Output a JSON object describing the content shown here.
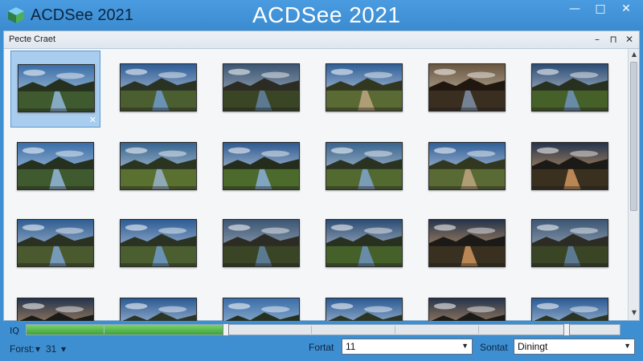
{
  "titlebar": {
    "app_name": "ACDSee 2021",
    "center_title": "ACDSee 2021",
    "minimize": "—",
    "maximize": "□",
    "close": "✕"
  },
  "panel": {
    "title": "Pecte Craet",
    "controls": [
      "–",
      "⊓",
      "✕"
    ]
  },
  "grid": {
    "selected_close": "✕",
    "thumbnails": [
      {
        "scene": "valley-river"
      },
      {
        "scene": "mountain-river"
      },
      {
        "scene": "castle-lake"
      },
      {
        "scene": "country-road"
      },
      {
        "scene": "cave-path"
      },
      {
        "scene": "tree-stream"
      },
      {
        "scene": "valley-river"
      },
      {
        "scene": "field-trees"
      },
      {
        "scene": "canal-reflection"
      },
      {
        "scene": "lake-field"
      },
      {
        "scene": "country-road"
      },
      {
        "scene": "sunset-horizon"
      },
      {
        "scene": "lake-town"
      },
      {
        "scene": "mountain-river"
      },
      {
        "scene": "castle-lake"
      },
      {
        "scene": "tree-stream"
      },
      {
        "scene": "sunset-horizon"
      },
      {
        "scene": "castle-lake"
      },
      {
        "scene": "sunset-horizon"
      },
      {
        "scene": "cloud-sky"
      },
      {
        "scene": "valley-river"
      },
      {
        "scene": "cloud-sky"
      },
      {
        "scene": "sunset-horizon"
      },
      {
        "scene": "cloud-sky"
      }
    ]
  },
  "scrollbar": {
    "up": "▲",
    "down": "▼"
  },
  "zoom": {
    "label": "IQ",
    "level": 0.33
  },
  "statusbar": {
    "font_label": "Forst:",
    "font_arrow": "▾",
    "font_value": "31",
    "format_label": "Fortat",
    "format_value": "11",
    "sort_label": "Sontat",
    "sort_value": "Diningt",
    "dropdown_arrow": "▼"
  },
  "colors": {
    "title_bar": "#3d8fd1",
    "progress_green": "#3fa23a",
    "selection": "#a9cdee"
  }
}
